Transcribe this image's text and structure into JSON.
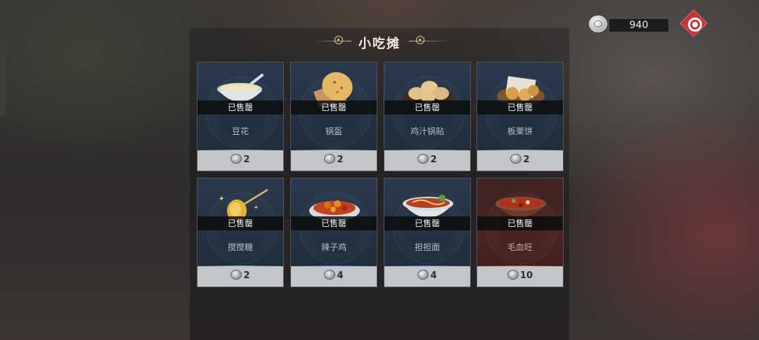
{
  "title": "小吃摊",
  "currency": {
    "amount": "940",
    "icon": "silver-coin-icon"
  },
  "colors": {
    "card_blue": "#22303f",
    "card_red": "#4a2420",
    "accent_teal": "#7fb3b8",
    "accent_blue": "#3e78d8",
    "accent_red": "#d94a3a",
    "menu_red": "#c7343a"
  },
  "items": [
    {
      "name": "豆花",
      "status": "已售罄",
      "price": "2",
      "icon": "tofu-pudding-icon"
    },
    {
      "name": "锅盔",
      "status": "已售罄",
      "price": "2",
      "icon": "flatbread-icon"
    },
    {
      "name": "鸡汁锅贴",
      "status": "已售罄",
      "price": "2",
      "icon": "potstickers-icon"
    },
    {
      "name": "板栗饼",
      "status": "已售罄",
      "price": "2",
      "icon": "chestnut-cake-icon"
    },
    {
      "name": "搅搅糖",
      "status": "已售罄",
      "price": "2",
      "icon": "candy-stick-icon"
    },
    {
      "name": "辣子鸡",
      "status": "已售罄",
      "price": "4",
      "icon": "spicy-chicken-icon"
    },
    {
      "name": "担担面",
      "status": "已售罄",
      "price": "4",
      "icon": "dandan-noodles-icon"
    },
    {
      "name": "毛血旺",
      "status": "已售罄",
      "price": "10",
      "icon": "spicy-blood-stew-icon"
    }
  ]
}
